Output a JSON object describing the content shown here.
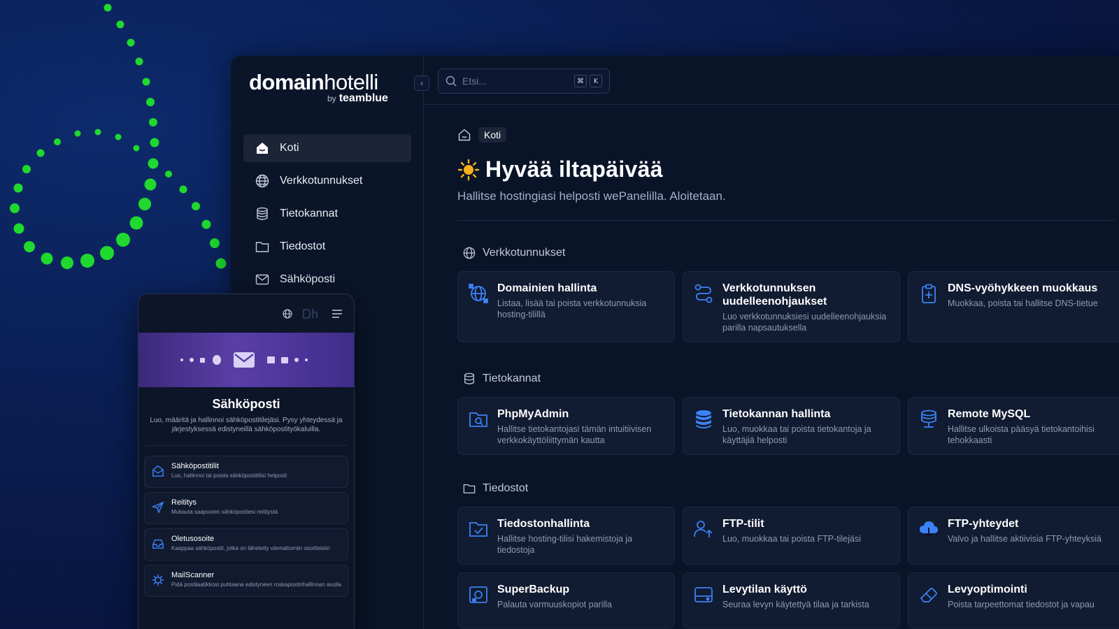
{
  "colors": {
    "accent": "#3b82f6",
    "dots": "#1fd92f",
    "background": "#0a1f55"
  },
  "brand": {
    "name_bold": "domain",
    "name_light": "hotelli",
    "by": "by",
    "company": "teamblue"
  },
  "sidebar": {
    "items": [
      {
        "label": "Koti",
        "icon": "home-icon",
        "active": true
      },
      {
        "label": "Verkkotunnukset",
        "icon": "globe-icon"
      },
      {
        "label": "Tietokannat",
        "icon": "database-icon"
      },
      {
        "label": "Tiedostot",
        "icon": "folder-icon"
      },
      {
        "label": "Sähköposti",
        "icon": "mail-icon"
      }
    ]
  },
  "search": {
    "placeholder": "Etsi...",
    "shortcut_mod": "⌘",
    "shortcut_key": "K"
  },
  "breadcrumb": {
    "current": "Koti"
  },
  "greeting": {
    "title": "Hyvää iltapäivää",
    "subtitle": "Hallitse hostingiasi helposti wePanelilla. Aloitetaan."
  },
  "sections": [
    {
      "title": "Verkkotunnukset",
      "cards": [
        {
          "title": "Domainien hallinta",
          "desc": "Listaa, lisää tai poista verkkotunnuksia hosting-tilillä",
          "icon": "network-globe-icon"
        },
        {
          "title": "Verkkotunnuksen uudelleenohjaukset",
          "desc": "Luo verkkotunnuksiesi uudelleenohjauksia parilla napsautuksella",
          "icon": "redirect-icon"
        },
        {
          "title": "DNS-vyöhykkeen muokkaus",
          "desc": "Muokkaa, poista tai hallitse DNS-tietue",
          "icon": "clipboard-plus-icon"
        }
      ]
    },
    {
      "title": "Tietokannat",
      "cards": [
        {
          "title": "PhpMyAdmin",
          "desc": "Hallitse tietokantojasi tämän intuitiivisen verkkokäyttöliittymän kautta",
          "icon": "folder-search-icon"
        },
        {
          "title": "Tietokannan hallinta",
          "desc": "Luo, muokkaa tai poista tietokantoja ja käyttäjiä helposti",
          "icon": "database-stack-icon"
        },
        {
          "title": "Remote MySQL",
          "desc": "Hallitse ulkoista pääsyä tietokantoihisi tehokkaasti",
          "icon": "remote-database-icon"
        }
      ]
    },
    {
      "title": "Tiedostot",
      "cards": [
        {
          "title": "Tiedostonhallinta",
          "desc": "Hallitse hosting-tilisi hakemistoja ja tiedostoja",
          "icon": "folder-check-icon"
        },
        {
          "title": "FTP-tilit",
          "desc": "Luo, muokkaa tai poista FTP-tilejäsi",
          "icon": "users-upload-icon"
        },
        {
          "title": "FTP-yhteydet",
          "desc": "Valvo ja hallitse aktiivisia FTP-yhteyksiä",
          "icon": "cloud-download-icon"
        }
      ]
    },
    {
      "title": "",
      "cards": [
        {
          "title": "SuperBackup",
          "desc": "Palauta varmuuskopiot parilla",
          "icon": "backup-icon"
        },
        {
          "title": "Levytilan käyttö",
          "desc": "Seuraa levyn käytettyä tilaa ja tarkista",
          "icon": "disk-icon"
        },
        {
          "title": "Levyoptimointi",
          "desc": "Poista tarpeettomat tiedostot ja vapau",
          "icon": "eraser-icon"
        }
      ]
    }
  ],
  "mobile": {
    "title": "Sähköposti",
    "desc": "Luo, määritä ja hallinnoi sähköpostitilejäsi. Pysy yhteydessä ja järjestyksessä edistyneillä sähköpostityökaluilla.",
    "items": [
      {
        "title": "Sähköpostitilit",
        "desc": "Luo, hallinnoi tai poista sähköpostitilisi helposti",
        "icon": "mail-open-icon"
      },
      {
        "title": "Reititys",
        "desc": "Mukauta saapuvien sähköpostiesi reititystä",
        "icon": "send-icon"
      },
      {
        "title": "Oletusosoite",
        "desc": "Kaappaa sähköpostit, jotka on lähetetty olemattomiin osoitteisiin",
        "icon": "inbox-icon"
      },
      {
        "title": "MailScanner",
        "desc": "Pidä postilaatikkosi puhtaana edistyneen roskapostinhallinnan avulla",
        "icon": "virus-icon"
      }
    ]
  }
}
